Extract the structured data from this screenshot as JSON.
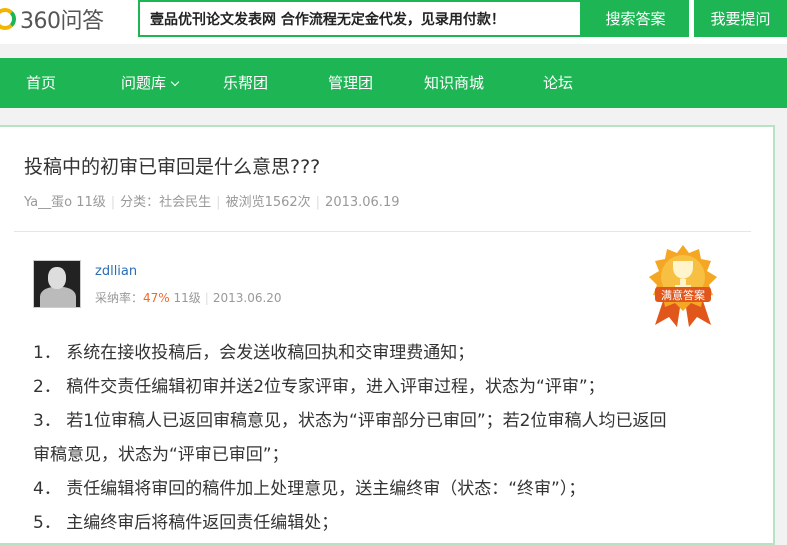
{
  "header": {
    "logo_text": "360问答",
    "ad_text": "壹品优刊论文发表网   合作流程无定金代发，见录用付款！",
    "search_button": "搜索答案",
    "ask_button": "我要提问"
  },
  "nav": {
    "items": [
      {
        "label": "首页"
      },
      {
        "label": "问题库"
      },
      {
        "label": "乐帮团"
      },
      {
        "label": "管理团"
      },
      {
        "label": "知识商城"
      },
      {
        "label": "论坛"
      }
    ]
  },
  "question": {
    "title": "投稿中的初审已审回是什么意思???",
    "asker": "Ya__蛋o",
    "asker_level": "11级",
    "category": "分类：社会民生",
    "views": "被浏览1562次",
    "date": "2013.06.19"
  },
  "answer": {
    "user": "zdllian",
    "adoption_label": "采纳率：",
    "adoption_rate": "47%",
    "level": "11级",
    "date": "2013.06.20",
    "badge_text": "满意答案",
    "lines": [
      "1．  系统在接收投稿后，会发送收稿回执和交审理费通知；",
      "  2．  稿件交责任编辑初审并送2位专家评审，进入评审过程，状态为“评审”；",
      "  3．  若1位审稿人已返回审稿意见，状态为“评审部分已审回”；若2位审稿人均已返回",
      "审稿意见，状态为“评审已审回”；",
      "  4．  责任编辑将审回的稿件加上处理意见，送主编终审（状态：“终审”）；",
      "  5．  主编终审后将稿件返回责任编辑处；"
    ]
  },
  "colors": {
    "brand_green": "#1eb554",
    "link_blue": "#2a6db5",
    "rate_orange": "#f06b2a",
    "badge_gold": "#f5a623"
  }
}
